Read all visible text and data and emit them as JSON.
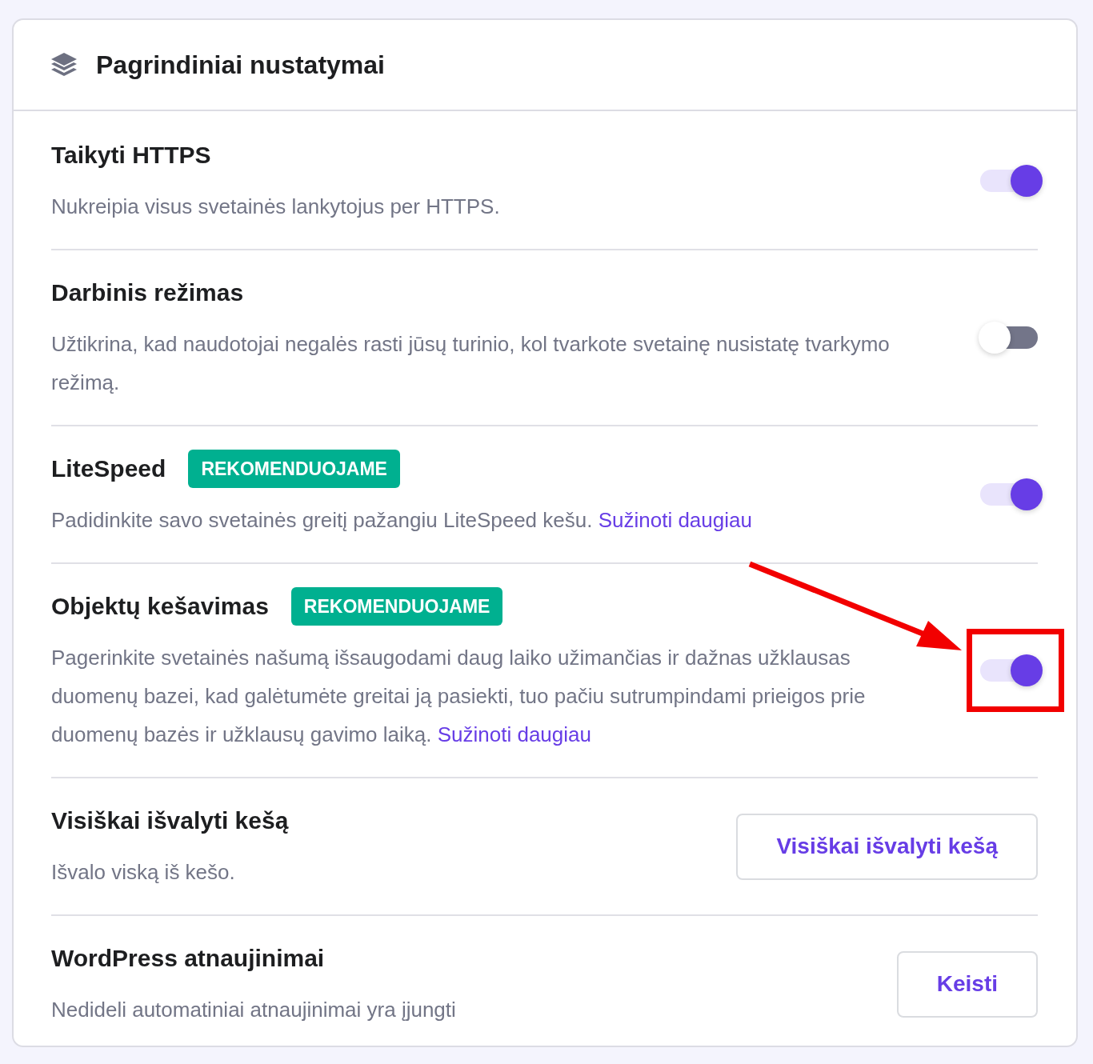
{
  "panel": {
    "title": "Pagrindiniai nustatymai"
  },
  "rows": [
    {
      "kind": "toggle",
      "title": "Taikyti HTTPS",
      "description": "Nukreipia visus svetainės lankytojus per HTTPS.",
      "on": true,
      "highlighted": false
    },
    {
      "kind": "toggle",
      "title": "Darbinis režimas",
      "description": "Užtikrina, kad naudotojai negalės rasti jūsų turinio, kol tvarkote svetainę nusistatę tvarkymo režimą.",
      "on": false,
      "highlighted": false
    },
    {
      "kind": "toggle",
      "title": "LiteSpeed",
      "badge": "REKOMENDUOJAME",
      "description": "Padidinkite savo svetainės greitį pažangiu LiteSpeed kešu.",
      "link": "Sužinoti daugiau",
      "on": true,
      "highlighted": false
    },
    {
      "kind": "toggle",
      "title": "Objektų kešavimas",
      "badge": "REKOMENDUOJAME",
      "description": "Pagerinkite svetainės našumą išsaugodami daug laiko užimančias ir dažnas užklausas duomenų bazei, kad galėtumėte greitai ją pasiekti, tuo pačiu sutrumpindami prieigos prie duomenų bazės ir užklausų gavimo laiką.",
      "link": "Sužinoti daugiau",
      "on": true,
      "highlighted": true
    },
    {
      "kind": "button",
      "title": "Visiškai išvalyti kešą",
      "description": "Išvalo viską iš kešo.",
      "button": "Visiškai išvalyti kešą",
      "highlighted": false
    },
    {
      "kind": "button",
      "title": "WordPress atnaujinimai",
      "description": "Nedideli automatiniai atnaujinimai yra įjungti",
      "button": "Keisti",
      "highlighted": false
    }
  ]
}
